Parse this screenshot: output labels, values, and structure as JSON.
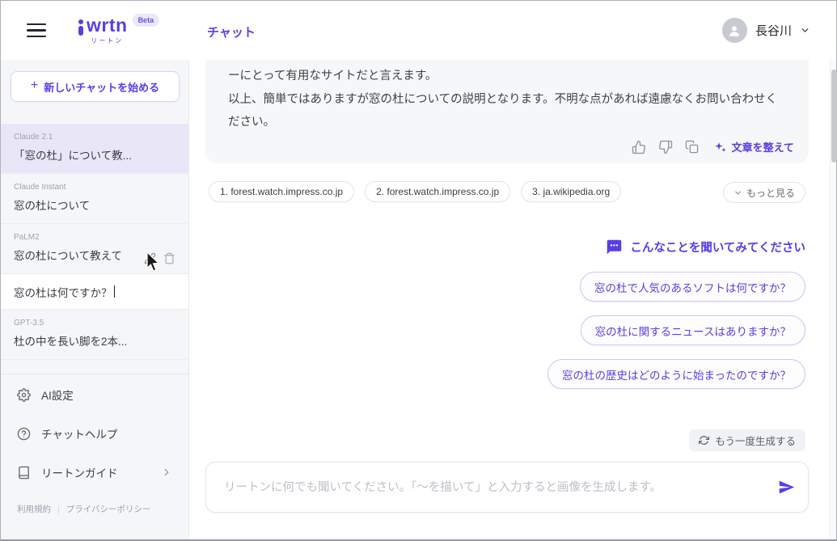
{
  "accent_color": "#5b3de8",
  "header": {
    "logo_text": "wrtn",
    "logo_subtext": "リートン",
    "beta_badge": "Beta",
    "nav": [
      {
        "label": "チャット"
      }
    ],
    "user": {
      "name": "長谷川"
    }
  },
  "sidebar": {
    "new_chat_button": "新しいチャットを始める",
    "history": [
      {
        "model": "Claude 2.1",
        "title": "「窓の杜」について教..."
      },
      {
        "model": "Claude Instant",
        "title": "窓の杜について"
      },
      {
        "model": "PaLM2",
        "title": "窓の杜について教えて"
      },
      {
        "model": "",
        "title": "窓の杜は何ですか？"
      },
      {
        "model": "GPT-3.5",
        "title": "杜の中を長い脚を2本..."
      }
    ],
    "menu": [
      {
        "label": "AI設定",
        "icon": "gear-icon"
      },
      {
        "label": "チャットヘルプ",
        "icon": "help-icon"
      },
      {
        "label": "リートンガイド",
        "icon": "guide-icon"
      }
    ],
    "legal": {
      "terms": "利用規約",
      "privacy": "プライバシーポリシー"
    }
  },
  "chat": {
    "assistant_message": {
      "line1": "ーにとって有用なサイトだと言えます。",
      "line2": "以上、簡単ではありますが窓の杜についての説明となります。不明な点があれば遠慮なくお問い合わせください。"
    },
    "polish_button": "文章を整えて",
    "sources": [
      {
        "label": "1. forest.watch.impress.co.jp"
      },
      {
        "label": "2. forest.watch.impress.co.jp"
      },
      {
        "label": "3. ja.wikipedia.org"
      }
    ],
    "more_button": "もっと見る",
    "suggestions_header": "こんなことを聞いてみてください",
    "suggestions": [
      {
        "label": "窓の杜で人気のあるソフトは何ですか？"
      },
      {
        "label": "窓の杜に関するニュースはありますか？"
      },
      {
        "label": "窓の杜の歴史はどのように始まったのですか？"
      }
    ],
    "regenerate_button": "もう一度生成する",
    "input_placeholder": "リートンに何でも聞いてください。「〜を描いて」と入力すると画像を生成します。"
  }
}
